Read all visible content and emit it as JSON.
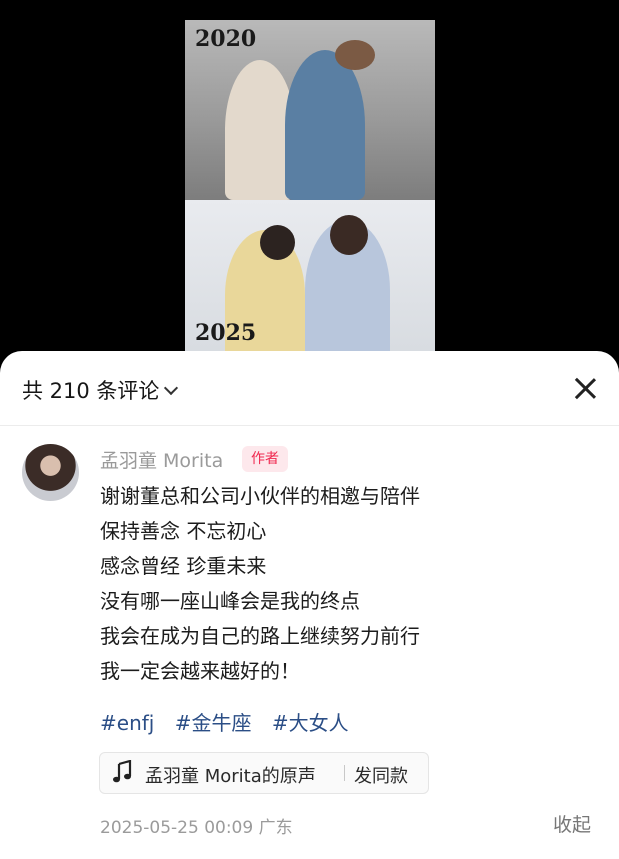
{
  "video": {
    "year_top": "2020",
    "year_bottom": "2025"
  },
  "comments": {
    "header": {
      "count_label": "共 210 条评论",
      "close_icon": "close-icon"
    },
    "pinned": {
      "author": "孟羽童 Morita",
      "badge": "作者",
      "lines": [
        "谢谢董总和公司小伙伴的相邀与陪伴",
        "保持善念 不忘初心",
        "感念曾经 珍重未来",
        "没有哪一座山峰会是我的终点",
        "我会在成为自己的路上继续努力前行",
        "我一定会越来越好的！"
      ],
      "tags": [
        "#enfj",
        "#金牛座",
        "#大女人"
      ],
      "music": {
        "icon": "music-note-icon",
        "name": "孟羽童 Morita的原声",
        "action": "发同款"
      },
      "timestamp": "2025-05-25 00:09 广东",
      "collapse_label": "收起"
    }
  }
}
